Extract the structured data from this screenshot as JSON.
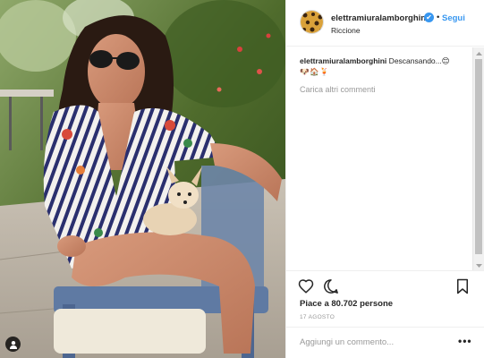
{
  "post": {
    "username": "elettramiuralamborghini",
    "verified_badge": "✔",
    "separator": "•",
    "follow_label": "Segui",
    "location": "Riccione",
    "caption_user": "elettramiuralamborghini",
    "caption_text": " Descansando...😊",
    "caption_emojis": "🐶🏠🍹",
    "load_more_label": "Carica altri commenti",
    "likes": "Piace a 80.702 persone",
    "date": "17 AGOSTO",
    "comment_placeholder": "Aggiungi un commento...",
    "more_options": "•••"
  },
  "icons": {
    "like": "heart-outline-icon",
    "comment": "comment-bubble-icon",
    "save": "bookmark-icon",
    "tag": "user-tag-icon",
    "verified": "verified-check-icon"
  },
  "colors": {
    "link_blue": "#3897f0",
    "text": "#262626",
    "muted": "#999999",
    "border": "#efefef"
  }
}
